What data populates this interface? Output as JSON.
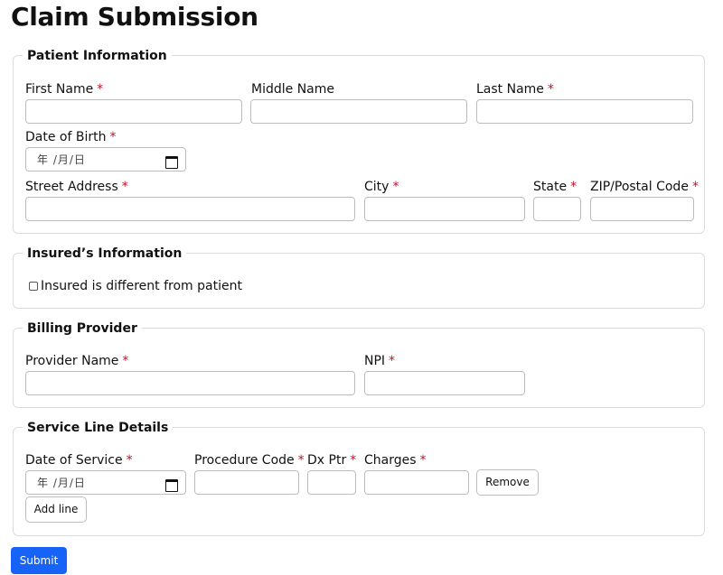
{
  "page": {
    "title": "Claim Submission"
  },
  "patient": {
    "legend": "Patient Information",
    "first_name_label": "First Name",
    "middle_name_label": "Middle Name",
    "last_name_label": "Last Name",
    "dob_label": "Date of Birth",
    "dob_placeholder": "年 /月/日",
    "street_label": "Street Address",
    "city_label": "City",
    "state_label": "State",
    "zip_label": "ZIP/Postal Code",
    "required_mark": "*"
  },
  "insured": {
    "legend": "Insured’s Information",
    "different_checkbox_label": "Insured is different from patient",
    "different_checked": false
  },
  "billing": {
    "legend": "Billing Provider",
    "provider_name_label": "Provider Name",
    "npi_label": "NPI"
  },
  "service": {
    "legend": "Service Line Details",
    "date_label": "Date of Service",
    "date_placeholder": "年 /月/日",
    "procedure_label": "Procedure Code",
    "dx_label": "Dx Ptr",
    "charges_label": "Charges",
    "remove_label": "Remove",
    "add_line_label": "Add line"
  },
  "actions": {
    "submit_label": "Submit"
  },
  "colors": {
    "required": "#c0122a",
    "primary": "#1763f7",
    "border": "#dcdcdc"
  },
  "icons": {
    "date": "calendar-icon"
  }
}
